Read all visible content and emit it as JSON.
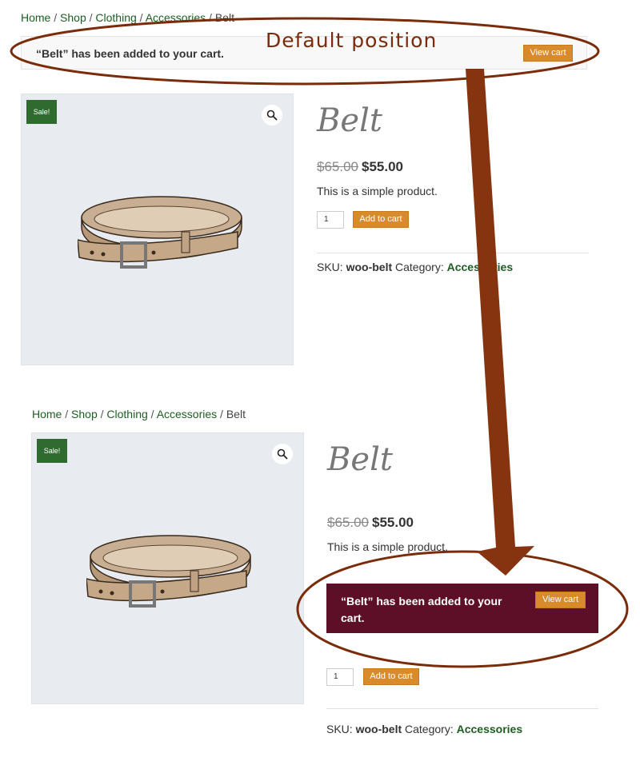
{
  "breadcrumb": {
    "home": "Home",
    "shop": "Shop",
    "clothing": "Clothing",
    "accessories": "Accessories",
    "current": "Belt",
    "separator": " / "
  },
  "notice": {
    "message": "“Belt” has been added to your cart.",
    "view_cart": "View cart"
  },
  "annotation": {
    "label": "Default position",
    "color": "#7a2c0a"
  },
  "product": {
    "sale_badge": "Sale!",
    "title": "Belt",
    "price_old": "$65.00",
    "price_new": "$55.00",
    "description": "This is a simple product.",
    "quantity": "1",
    "add_to_cart": "Add to cart",
    "sku_label": "SKU:",
    "sku": "woo-belt",
    "category_label": "Category:",
    "category": "Accessories"
  },
  "colors": {
    "link": "#1b5e20",
    "button": "#d98a2b",
    "moved_notice_bg": "#5e0f28",
    "sale_badge": "#2f6b2f"
  }
}
